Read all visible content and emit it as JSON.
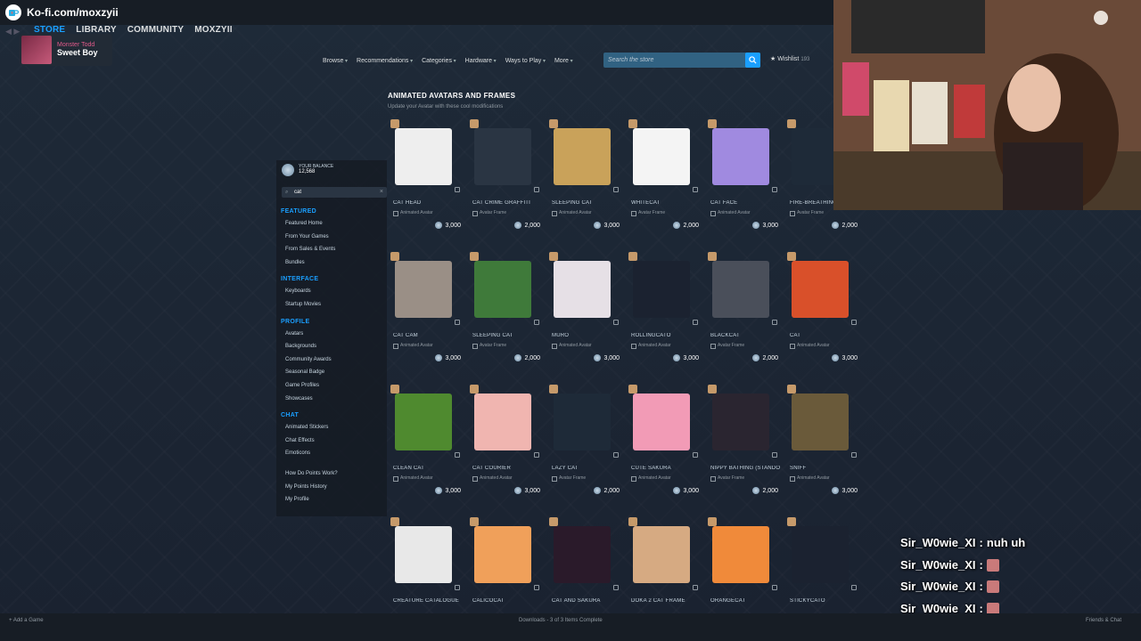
{
  "overlay": {
    "kofi_text": "Ko-fi.com/moxzyii"
  },
  "steam": {
    "nav": [
      "STORE",
      "LIBRARY",
      "COMMUNITY",
      "MOXZYII"
    ],
    "now_playing": {
      "artist": "Monster Todd",
      "song": "Sweet Boy"
    },
    "store_menu": [
      "Browse",
      "Recommendations",
      "Categories",
      "Hardware",
      "Ways to Play",
      "More"
    ],
    "search_placeholder": "Search the store",
    "wishlist_label": "Wishlist",
    "wishlist_count": "193"
  },
  "sidebar": {
    "balance_label": "YOUR BALANCE",
    "balance_amount": "12,568",
    "search_value": "cat",
    "sections": [
      {
        "title": "FEATURED",
        "items": [
          "Featured Home",
          "From Your Games",
          "From Sales & Events",
          "Bundles"
        ]
      },
      {
        "title": "INTERFACE",
        "items": [
          "Keyboards",
          "Startup Movies"
        ]
      },
      {
        "title": "PROFILE",
        "items": [
          "Avatars",
          "Backgrounds",
          "Community Awards",
          "Seasonal Badge",
          "Game Profiles",
          "Showcases"
        ]
      },
      {
        "title": "CHAT",
        "items": [
          "Animated Stickers",
          "Chat Effects",
          "Emoticons"
        ]
      }
    ],
    "extra_links": [
      "How Do Points Work?",
      "My Points History",
      "My Profile"
    ]
  },
  "main": {
    "title": "ANIMATED AVATARS AND FRAMES",
    "subtitle": "Update your Avatar with these cool modifications",
    "items": [
      {
        "name": "CAT HEAD",
        "type": "Animated Avatar",
        "price": "3,000",
        "color": "#eeeeee"
      },
      {
        "name": "CAT CRIME GRAFFITI",
        "type": "Avatar Frame",
        "price": "2,000",
        "color": "#2a3543"
      },
      {
        "name": "SLEEPING CAT",
        "type": "Animated Avatar",
        "price": "3,000",
        "color": "#c9a25a"
      },
      {
        "name": "WHITECAT",
        "type": "Avatar Frame",
        "price": "2,000",
        "color": "#f4f4f4"
      },
      {
        "name": "CAT FACE",
        "type": "Animated Avatar",
        "price": "3,000",
        "color": "#a08ae0"
      },
      {
        "name": "FIRE-BREATHING",
        "type": "Avatar Frame",
        "price": "2,000",
        "color": "#1e2a38"
      },
      {
        "name": "CAT CAM",
        "type": "Animated Avatar",
        "price": "3,000",
        "color": "#9a8f86"
      },
      {
        "name": "SLEEPING CAT",
        "type": "Avatar Frame",
        "price": "2,000",
        "color": "#3f7a3a"
      },
      {
        "name": "MURO",
        "type": "Animated Avatar",
        "price": "3,000",
        "color": "#e6e0e6"
      },
      {
        "name": "ROLLINGCATO",
        "type": "Animated Avatar",
        "price": "3,000",
        "color": "#1b2230"
      },
      {
        "name": "BLACKCAT",
        "type": "Avatar Frame",
        "price": "2,000",
        "color": "#4a4f5a"
      },
      {
        "name": "CAT",
        "type": "Animated Avatar",
        "price": "3,000",
        "color": "#d9502a"
      },
      {
        "name": "CLEAN CAT",
        "type": "Animated Avatar",
        "price": "3,000",
        "color": "#4f8a2f"
      },
      {
        "name": "CAT COURIER",
        "type": "Animated Avatar",
        "price": "3,000",
        "color": "#f0b5b0"
      },
      {
        "name": "LAZY CAT",
        "type": "Avatar Frame",
        "price": "2,000",
        "color": "#1e2a38"
      },
      {
        "name": "CUTE SAKURA",
        "type": "Animated Avatar",
        "price": "3,000",
        "color": "#f29bb6"
      },
      {
        "name": "NIPPY BATHING (STANDO",
        "type": "Avatar Frame",
        "price": "2,000",
        "color": "#2a2530"
      },
      {
        "name": "SNIFF",
        "type": "Animated Avatar",
        "price": "3,000",
        "color": "#6a5a3a"
      },
      {
        "name": "CREATURE CATALOGUE",
        "type": "",
        "price": "",
        "color": "#e8e8e8"
      },
      {
        "name": "CALICOCAT",
        "type": "",
        "price": "",
        "color": "#f0a05a"
      },
      {
        "name": "CAT AND SAKURA",
        "type": "",
        "price": "",
        "color": "#2a1a2a"
      },
      {
        "name": "DOKA 2 CAT FRAME",
        "type": "",
        "price": "",
        "color": "#d6aa82"
      },
      {
        "name": "ORANGECAT",
        "type": "",
        "price": "",
        "color": "#f08a3a"
      },
      {
        "name": "STICKYCATO",
        "type": "",
        "price": "",
        "color": "#1b2230"
      }
    ]
  },
  "bottombar": {
    "add_game": "Add a Game",
    "downloads": "Downloads - 3 of 3 Items Complete",
    "friends_chat": "Friends & Chat"
  },
  "chat": {
    "messages": [
      {
        "user": "Sir_W0wie_XI",
        "text": "nuh uh",
        "emote": false
      },
      {
        "user": "Sir_W0wie_XI",
        "text": "",
        "emote": true
      },
      {
        "user": "Sir_W0wie_XI",
        "text": "",
        "emote": true
      },
      {
        "user": "Sir_W0wie_XI",
        "text": "",
        "emote": true
      },
      {
        "user": "Sir_W0wie_XI",
        "text": "",
        "emote": true
      }
    ]
  }
}
